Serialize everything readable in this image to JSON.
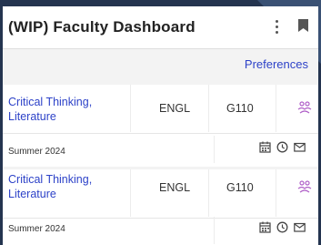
{
  "header": {
    "title": "(WIP) Faculty Dashboard",
    "menu_icon": "kebab-icon",
    "bookmark_icon": "bookmark-icon"
  },
  "preferences_label": "Preferences",
  "courses": [
    {
      "title": "Critical Thinking, Literature",
      "subject": "ENGL",
      "section": "G110",
      "term": "Summer 2024"
    },
    {
      "title": "Critical Thinking, Literature",
      "subject": "ENGL",
      "section": "G110",
      "term": "Summer 2024"
    }
  ],
  "colors": {
    "link": "#2d42c8",
    "people_icon": "#b060c8",
    "background": "#24344f"
  }
}
